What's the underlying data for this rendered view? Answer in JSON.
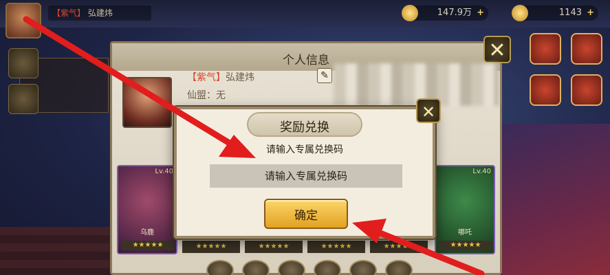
{
  "hud": {
    "player_tag": "【紫气】",
    "player_name": "弘建炜",
    "currency_1": "147.9万",
    "currency_2": "1143"
  },
  "info_panel": {
    "title": "个人信息",
    "name_tag": "【紫气】",
    "name": "弘建炜",
    "guild_label": "仙盟：",
    "guild_value": "无",
    "hero_left_level": "Lv.40",
    "hero_left_name": "乌鹿",
    "hero_right_level": "Lv.40",
    "hero_right_name": "哪吒",
    "stars": "★★★★★"
  },
  "dialog": {
    "title": "奖励兑换",
    "prompt": "请输入专属兑换码",
    "input_placeholder": "请输入专属兑换码",
    "input_value": "",
    "confirm_label": "确定"
  },
  "colors": {
    "accent_red": "#e0442a",
    "button_gold": "#f3c24a",
    "annotation_arrow": "#e21d1d"
  },
  "icons": {
    "panel_close": "close-x-icon",
    "dialog_close": "close-x-icon",
    "edit": "pencil-icon"
  }
}
